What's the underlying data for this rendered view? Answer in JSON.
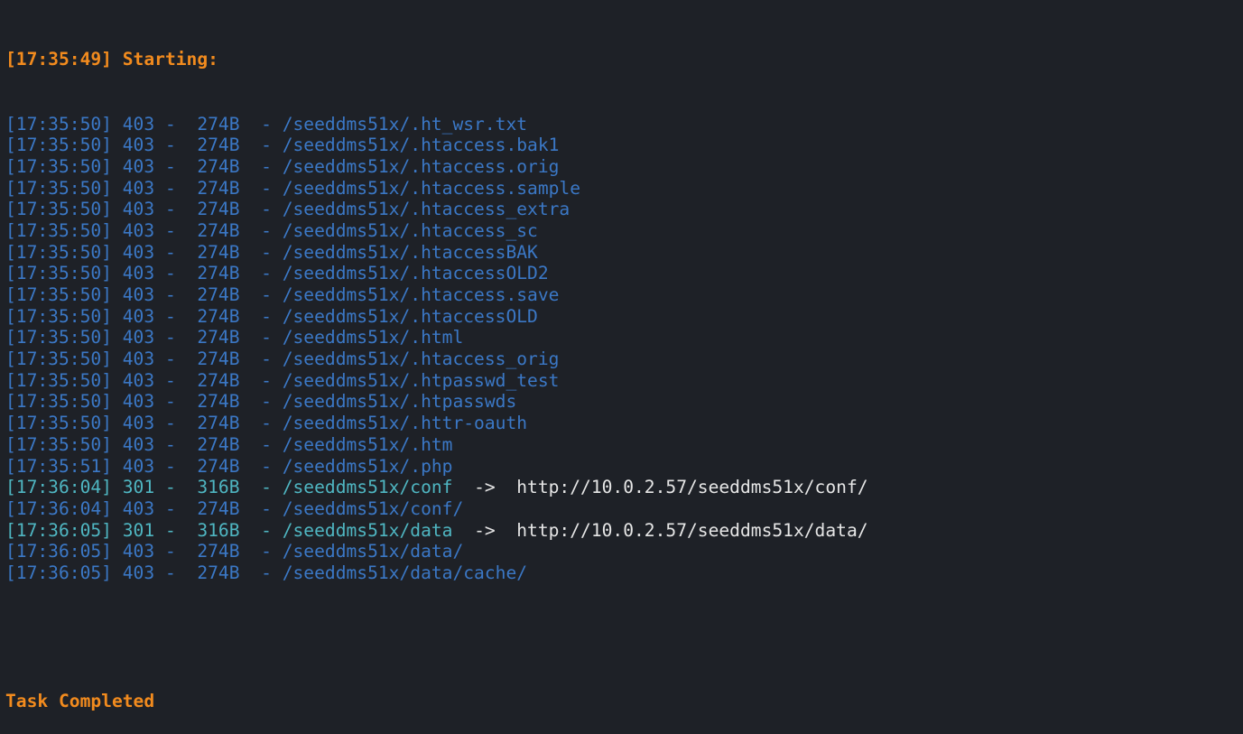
{
  "header": {
    "timestamp": "[17:35:49]",
    "label": "Starting:"
  },
  "entries": [
    {
      "timestamp": "[17:35:50]",
      "status": "403",
      "size": "274B",
      "path": "/seeddms51x/.ht_wsr.txt",
      "redirect": ""
    },
    {
      "timestamp": "[17:35:50]",
      "status": "403",
      "size": "274B",
      "path": "/seeddms51x/.htaccess.bak1",
      "redirect": ""
    },
    {
      "timestamp": "[17:35:50]",
      "status": "403",
      "size": "274B",
      "path": "/seeddms51x/.htaccess.orig",
      "redirect": ""
    },
    {
      "timestamp": "[17:35:50]",
      "status": "403",
      "size": "274B",
      "path": "/seeddms51x/.htaccess.sample",
      "redirect": ""
    },
    {
      "timestamp": "[17:35:50]",
      "status": "403",
      "size": "274B",
      "path": "/seeddms51x/.htaccess_extra",
      "redirect": ""
    },
    {
      "timestamp": "[17:35:50]",
      "status": "403",
      "size": "274B",
      "path": "/seeddms51x/.htaccess_sc",
      "redirect": ""
    },
    {
      "timestamp": "[17:35:50]",
      "status": "403",
      "size": "274B",
      "path": "/seeddms51x/.htaccessBAK",
      "redirect": ""
    },
    {
      "timestamp": "[17:35:50]",
      "status": "403",
      "size": "274B",
      "path": "/seeddms51x/.htaccessOLD2",
      "redirect": ""
    },
    {
      "timestamp": "[17:35:50]",
      "status": "403",
      "size": "274B",
      "path": "/seeddms51x/.htaccess.save",
      "redirect": ""
    },
    {
      "timestamp": "[17:35:50]",
      "status": "403",
      "size": "274B",
      "path": "/seeddms51x/.htaccessOLD",
      "redirect": ""
    },
    {
      "timestamp": "[17:35:50]",
      "status": "403",
      "size": "274B",
      "path": "/seeddms51x/.html",
      "redirect": ""
    },
    {
      "timestamp": "[17:35:50]",
      "status": "403",
      "size": "274B",
      "path": "/seeddms51x/.htaccess_orig",
      "redirect": ""
    },
    {
      "timestamp": "[17:35:50]",
      "status": "403",
      "size": "274B",
      "path": "/seeddms51x/.htpasswd_test",
      "redirect": ""
    },
    {
      "timestamp": "[17:35:50]",
      "status": "403",
      "size": "274B",
      "path": "/seeddms51x/.htpasswds",
      "redirect": ""
    },
    {
      "timestamp": "[17:35:50]",
      "status": "403",
      "size": "274B",
      "path": "/seeddms51x/.httr-oauth",
      "redirect": ""
    },
    {
      "timestamp": "[17:35:50]",
      "status": "403",
      "size": "274B",
      "path": "/seeddms51x/.htm",
      "redirect": ""
    },
    {
      "timestamp": "[17:35:51]",
      "status": "403",
      "size": "274B",
      "path": "/seeddms51x/.php",
      "redirect": ""
    },
    {
      "timestamp": "[17:36:04]",
      "status": "301",
      "size": "316B",
      "path": "/seeddms51x/conf",
      "redirect": "http://10.0.2.57/seeddms51x/conf/"
    },
    {
      "timestamp": "[17:36:04]",
      "status": "403",
      "size": "274B",
      "path": "/seeddms51x/conf/",
      "redirect": ""
    },
    {
      "timestamp": "[17:36:05]",
      "status": "301",
      "size": "316B",
      "path": "/seeddms51x/data",
      "redirect": "http://10.0.2.57/seeddms51x/data/"
    },
    {
      "timestamp": "[17:36:05]",
      "status": "403",
      "size": "274B",
      "path": "/seeddms51x/data/",
      "redirect": ""
    },
    {
      "timestamp": "[17:36:05]",
      "status": "403",
      "size": "274B",
      "path": "/seeddms51x/data/cache/",
      "redirect": ""
    }
  ],
  "separator": "-",
  "arrow": "->",
  "footer": {
    "label": "Task Completed"
  },
  "colors": {
    "background": "#1e2127",
    "header": "#f28b1e",
    "status_403": "#3b78c6",
    "status_301": "#4fb6c2",
    "redirect_url": "#e6e6e6"
  }
}
